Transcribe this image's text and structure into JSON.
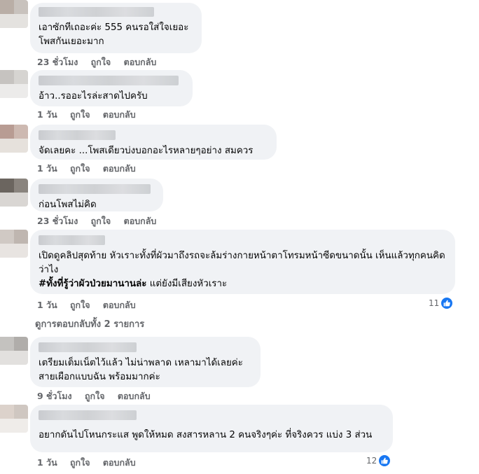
{
  "comments": [
    {
      "text": "เอาซักทีเถอะค่ะ 555 คนรอใส่ใจเยอะ\nโพสกันเยอะมาก",
      "time": "23 ชั่วโมง",
      "like_label": "ถูกใจ",
      "reply_label": "ตอบกลับ"
    },
    {
      "text": "อ้าว..รออะไรล่ะสาดไปครับ",
      "time": "1 วัน",
      "like_label": "ถูกใจ",
      "reply_label": "ตอบกลับ"
    },
    {
      "text": "จัดเลยคะ ...โพสเดียวบ่งบอกอะไรหลายๆอย่าง สมควร",
      "time": "1 วัน",
      "like_label": "ถูกใจ",
      "reply_label": "ตอบกลับ"
    },
    {
      "text": "ก่อนโพสไม่คิด",
      "time": "23 ชั่วโมง",
      "like_label": "ถูกใจ",
      "reply_label": "ตอบกลับ"
    },
    {
      "text": "เปิดดูคลิปสุดท้าย หัวเราะทั้งที่ผัวมาถึงรถจะล้มร่างกายหน้าตาโทรมหน้าซีดขนาดนั้น เห็นแล้วทุกคนคิดว่าไง",
      "hashtag": "#ทั้งที่รู้ว่าผัวป่วยมานานล่ะ",
      "text_after": " แต่ยังมีเสียงหัวเราะ",
      "time": "1 วัน",
      "like_label": "ถูกใจ",
      "reply_label": "ตอบกลับ",
      "reaction_count": "11",
      "view_replies": "ดูการตอบกลับทั้ง 2 รายการ"
    },
    {
      "text": "เตรียมเต็มเน็ตไว้แล้ว ไม่น่าพลาด เหลามาได้เลยค่ะ\nสายเผือกแบบฉัน พร้อมมากค่ะ",
      "time": "9 ชั่วโมง",
      "like_label": "ถูกใจ",
      "reply_label": "ตอบกลับ"
    },
    {
      "text": "อยากดันไปโหนกระแส พูดให้หมด สงสารหลาน 2 คนจริงๆค่ะ ที่จริงควร แบ่ง 3 ส่วน",
      "time": "1 วัน",
      "like_label": "ถูกใจ",
      "reply_label": "ตอบกลับ",
      "reaction_count": "12"
    }
  ],
  "icons": {
    "like": "thumbs-up-icon"
  },
  "colors": {
    "bubble": "#f0f2f5",
    "meta": "#65676b",
    "like_blue": "#1877f2"
  }
}
